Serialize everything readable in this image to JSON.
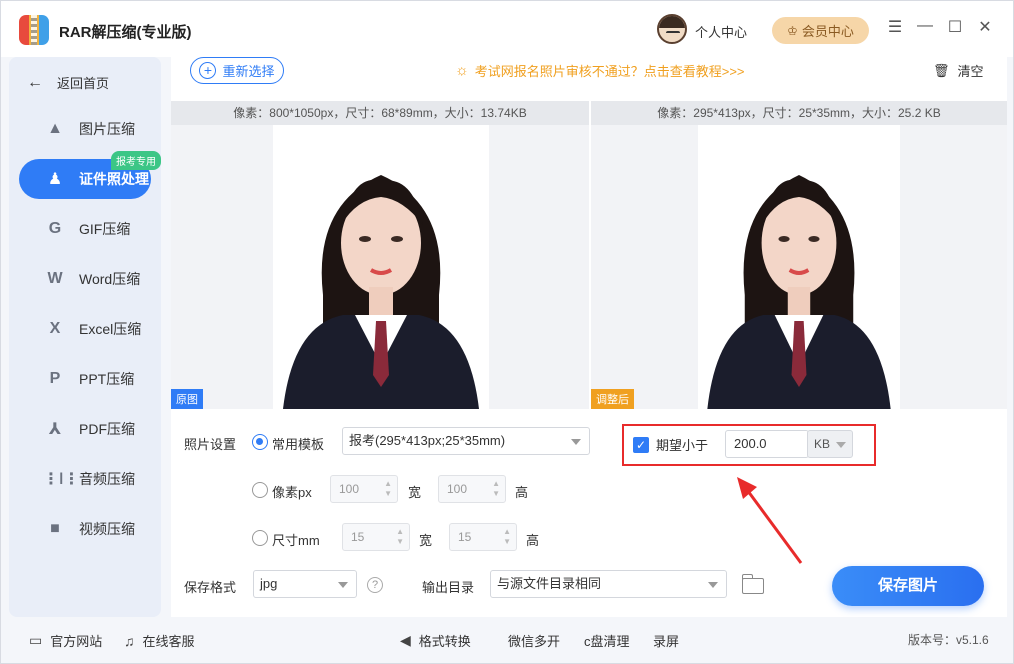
{
  "app": {
    "title": "RAR解压缩(专业版)",
    "user_center": "个人中心",
    "vip_center": "会员中心"
  },
  "sidebar": {
    "back": "返回首页",
    "badge": "报考专用",
    "items": [
      {
        "label": "图片压缩",
        "icon": "image-icon"
      },
      {
        "label": "证件照处理",
        "icon": "id-photo-icon"
      },
      {
        "label": "GIF压缩",
        "icon": "gif-icon"
      },
      {
        "label": "Word压缩",
        "icon": "word-icon"
      },
      {
        "label": "Excel压缩",
        "icon": "excel-icon"
      },
      {
        "label": "PPT压缩",
        "icon": "ppt-icon"
      },
      {
        "label": "PDF压缩",
        "icon": "pdf-icon"
      },
      {
        "label": "音频压缩",
        "icon": "audio-icon"
      },
      {
        "label": "视频压缩",
        "icon": "video-icon"
      }
    ],
    "active_index": 1
  },
  "toolbar": {
    "reselect": "重新选择",
    "tip": "考试网报名照片审核不通过？点击查看教程>>>",
    "clear": "清空"
  },
  "preview": {
    "original_info": "像素：800*1050px，尺寸：68*89mm，大小：13.74KB",
    "adjusted_info": "像素：295*413px，尺寸：25*35mm，大小：25.2 KB",
    "original_tag": "原图",
    "adjusted_tag": "调整后"
  },
  "settings": {
    "photo_settings_label": "照片设置",
    "mode_template": "常用模板",
    "template_value": "报考(295*413px;25*35mm)",
    "mode_pixel": "像素px",
    "pixel_width": "100",
    "pixel_height": "100",
    "width_label": "宽",
    "height_label": "高",
    "mode_size": "尺寸mm",
    "size_width": "15",
    "size_height": "15",
    "expect_label": "期望小于",
    "expect_value": "200.0",
    "expect_unit": "KB",
    "format_label": "保存格式",
    "format_value": "jpg",
    "output_label": "输出目录",
    "output_value": "与源文件目录相同",
    "save_button": "保存图片"
  },
  "footer": {
    "website": "官方网站",
    "support": "在线客服",
    "format_convert": "格式转换",
    "wechat_multi": "微信多开",
    "c_drive_clean": "c盘清理",
    "screen_record": "录屏",
    "version": "版本号：v5.1.6"
  },
  "colors": {
    "accent": "#2f7cf6",
    "badge_green": "#3cc686",
    "tip_orange": "#f0a020",
    "annotation_red": "#e82b2b",
    "vip_gold": "#f6d6a8"
  }
}
